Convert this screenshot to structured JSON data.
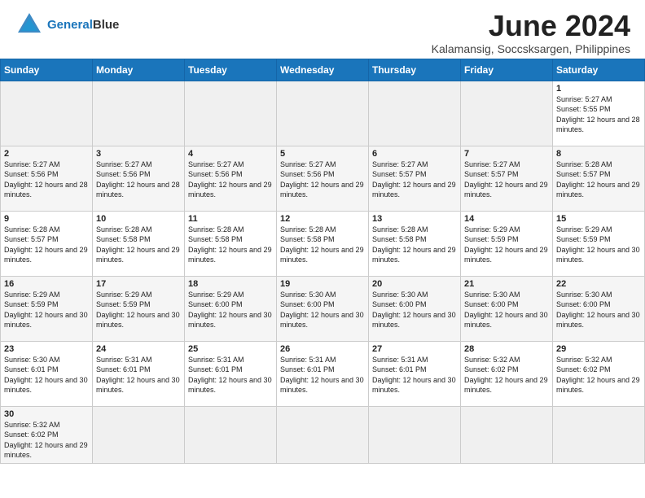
{
  "header": {
    "logo_line1": "General",
    "logo_line2": "Blue",
    "main_title": "June 2024",
    "subtitle": "Kalamansig, Soccsksargen, Philippines"
  },
  "weekdays": [
    "Sunday",
    "Monday",
    "Tuesday",
    "Wednesday",
    "Thursday",
    "Friday",
    "Saturday"
  ],
  "days": [
    [
      {
        "num": "",
        "info": ""
      },
      {
        "num": "",
        "info": ""
      },
      {
        "num": "",
        "info": ""
      },
      {
        "num": "",
        "info": ""
      },
      {
        "num": "",
        "info": ""
      },
      {
        "num": "",
        "info": ""
      },
      {
        "num": "1",
        "info": "Sunrise: 5:27 AM\nSunset: 5:55 PM\nDaylight: 12 hours and 28 minutes."
      }
    ],
    [
      {
        "num": "2",
        "info": "Sunrise: 5:27 AM\nSunset: 5:56 PM\nDaylight: 12 hours and 28 minutes."
      },
      {
        "num": "3",
        "info": "Sunrise: 5:27 AM\nSunset: 5:56 PM\nDaylight: 12 hours and 28 minutes."
      },
      {
        "num": "4",
        "info": "Sunrise: 5:27 AM\nSunset: 5:56 PM\nDaylight: 12 hours and 29 minutes."
      },
      {
        "num": "5",
        "info": "Sunrise: 5:27 AM\nSunset: 5:56 PM\nDaylight: 12 hours and 29 minutes."
      },
      {
        "num": "6",
        "info": "Sunrise: 5:27 AM\nSunset: 5:57 PM\nDaylight: 12 hours and 29 minutes."
      },
      {
        "num": "7",
        "info": "Sunrise: 5:27 AM\nSunset: 5:57 PM\nDaylight: 12 hours and 29 minutes."
      },
      {
        "num": "8",
        "info": "Sunrise: 5:28 AM\nSunset: 5:57 PM\nDaylight: 12 hours and 29 minutes."
      }
    ],
    [
      {
        "num": "9",
        "info": "Sunrise: 5:28 AM\nSunset: 5:57 PM\nDaylight: 12 hours and 29 minutes."
      },
      {
        "num": "10",
        "info": "Sunrise: 5:28 AM\nSunset: 5:58 PM\nDaylight: 12 hours and 29 minutes."
      },
      {
        "num": "11",
        "info": "Sunrise: 5:28 AM\nSunset: 5:58 PM\nDaylight: 12 hours and 29 minutes."
      },
      {
        "num": "12",
        "info": "Sunrise: 5:28 AM\nSunset: 5:58 PM\nDaylight: 12 hours and 29 minutes."
      },
      {
        "num": "13",
        "info": "Sunrise: 5:28 AM\nSunset: 5:58 PM\nDaylight: 12 hours and 29 minutes."
      },
      {
        "num": "14",
        "info": "Sunrise: 5:29 AM\nSunset: 5:59 PM\nDaylight: 12 hours and 29 minutes."
      },
      {
        "num": "15",
        "info": "Sunrise: 5:29 AM\nSunset: 5:59 PM\nDaylight: 12 hours and 30 minutes."
      }
    ],
    [
      {
        "num": "16",
        "info": "Sunrise: 5:29 AM\nSunset: 5:59 PM\nDaylight: 12 hours and 30 minutes."
      },
      {
        "num": "17",
        "info": "Sunrise: 5:29 AM\nSunset: 5:59 PM\nDaylight: 12 hours and 30 minutes."
      },
      {
        "num": "18",
        "info": "Sunrise: 5:29 AM\nSunset: 6:00 PM\nDaylight: 12 hours and 30 minutes."
      },
      {
        "num": "19",
        "info": "Sunrise: 5:30 AM\nSunset: 6:00 PM\nDaylight: 12 hours and 30 minutes."
      },
      {
        "num": "20",
        "info": "Sunrise: 5:30 AM\nSunset: 6:00 PM\nDaylight: 12 hours and 30 minutes."
      },
      {
        "num": "21",
        "info": "Sunrise: 5:30 AM\nSunset: 6:00 PM\nDaylight: 12 hours and 30 minutes."
      },
      {
        "num": "22",
        "info": "Sunrise: 5:30 AM\nSunset: 6:00 PM\nDaylight: 12 hours and 30 minutes."
      }
    ],
    [
      {
        "num": "23",
        "info": "Sunrise: 5:30 AM\nSunset: 6:01 PM\nDaylight: 12 hours and 30 minutes."
      },
      {
        "num": "24",
        "info": "Sunrise: 5:31 AM\nSunset: 6:01 PM\nDaylight: 12 hours and 30 minutes."
      },
      {
        "num": "25",
        "info": "Sunrise: 5:31 AM\nSunset: 6:01 PM\nDaylight: 12 hours and 30 minutes."
      },
      {
        "num": "26",
        "info": "Sunrise: 5:31 AM\nSunset: 6:01 PM\nDaylight: 12 hours and 30 minutes."
      },
      {
        "num": "27",
        "info": "Sunrise: 5:31 AM\nSunset: 6:01 PM\nDaylight: 12 hours and 30 minutes."
      },
      {
        "num": "28",
        "info": "Sunrise: 5:32 AM\nSunset: 6:02 PM\nDaylight: 12 hours and 29 minutes."
      },
      {
        "num": "29",
        "info": "Sunrise: 5:32 AM\nSunset: 6:02 PM\nDaylight: 12 hours and 29 minutes."
      }
    ],
    [
      {
        "num": "30",
        "info": "Sunrise: 5:32 AM\nSunset: 6:02 PM\nDaylight: 12 hours and 29 minutes."
      },
      {
        "num": "",
        "info": ""
      },
      {
        "num": "",
        "info": ""
      },
      {
        "num": "",
        "info": ""
      },
      {
        "num": "",
        "info": ""
      },
      {
        "num": "",
        "info": ""
      },
      {
        "num": "",
        "info": ""
      }
    ]
  ]
}
